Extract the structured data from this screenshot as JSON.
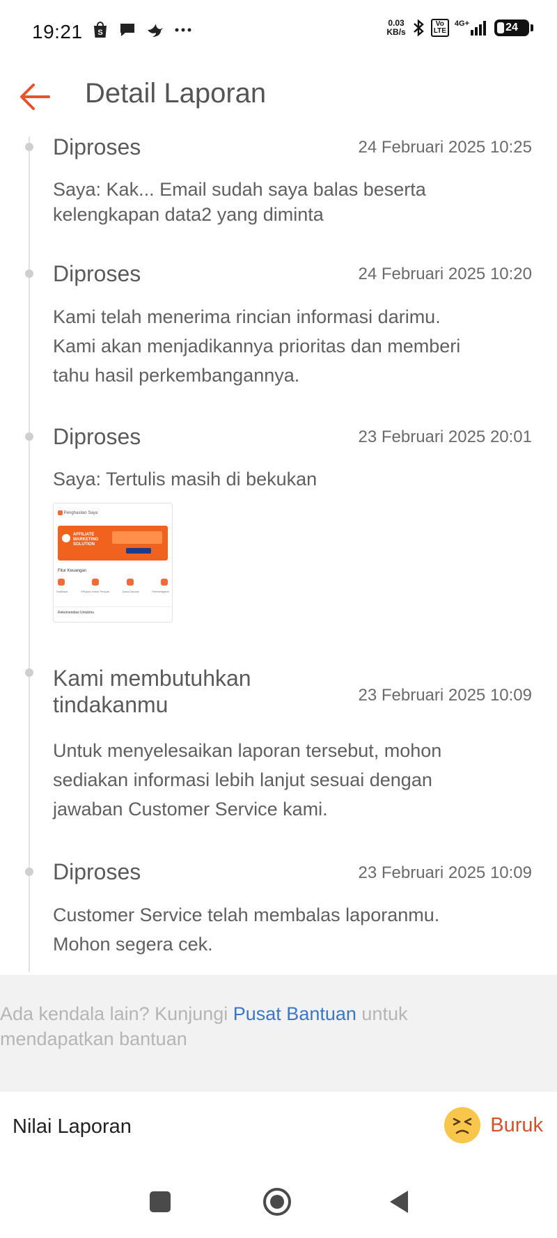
{
  "status_bar": {
    "time": "19:21",
    "net_speed_value": "0.03",
    "net_speed_unit": "KB/s",
    "volte_top": "Vo",
    "volte_bottom": "LTE",
    "network": "4G+",
    "battery": "24",
    "battery_fraction": 0.24
  },
  "header": {
    "title": "Detail Laporan"
  },
  "timeline": [
    {
      "status": "Diproses",
      "date": "24 Februari 2025 10:25",
      "desc_lines": [
        "Saya: Kak... Email sudah saya balas beserta",
        "kelengkapan data2 yang diminta"
      ]
    },
    {
      "status": "Diproses",
      "date": "24 Februari 2025 10:20",
      "desc_lines": [
        "Kami telah menerima rincian informasi darimu.",
        "Kami akan menjadikannya prioritas dan memberi",
        "tahu hasil perkembangannya."
      ]
    },
    {
      "status": "Diproses",
      "date": "23 Februari 2025 20:01",
      "desc_lines": [
        "Saya: Tertulis masih di bekukan"
      ],
      "attachment": {
        "header": "Penghasilan Saya",
        "banner_text": "AFFILIATE MARKETING SOLUTION",
        "section_title": "Fitur Keuangan",
        "items": [
          "SeaBank",
          "SPinjam Untuk Penjual",
          "Dana Darurat",
          "Pembelajaran"
        ],
        "footer": "Rekomendasi Untukmu"
      }
    },
    {
      "status_lines": [
        "Kami membutuhkan",
        "tindakanmu"
      ],
      "date": "23 Februari 2025 10:09",
      "desc_lines": [
        "Untuk menyelesaikan laporan tersebut, mohon",
        "sediakan informasi lebih lanjut sesuai dengan",
        "jawaban Customer Service kami."
      ]
    },
    {
      "status": "Diproses",
      "date": "23 Februari 2025 10:09",
      "desc_lines": [
        "Customer Service telah membalas laporanmu.",
        "Mohon segera cek."
      ]
    }
  ],
  "help": {
    "prefix": "Ada kendala lain? Kunjungi ",
    "link": "Pusat Bantuan",
    "suffix": " untuk",
    "line2": "mendapatkan bantuan"
  },
  "rating": {
    "label": "Nilai Laporan",
    "value": "Buruk",
    "emoji_icon": "dissatisfied-face-icon"
  },
  "colors": {
    "accent": "#e8532b",
    "link": "#3a78c5",
    "rating_text": "#d4522a",
    "emoji": "#f7c64a",
    "help_bg": "#f2f2f2"
  }
}
